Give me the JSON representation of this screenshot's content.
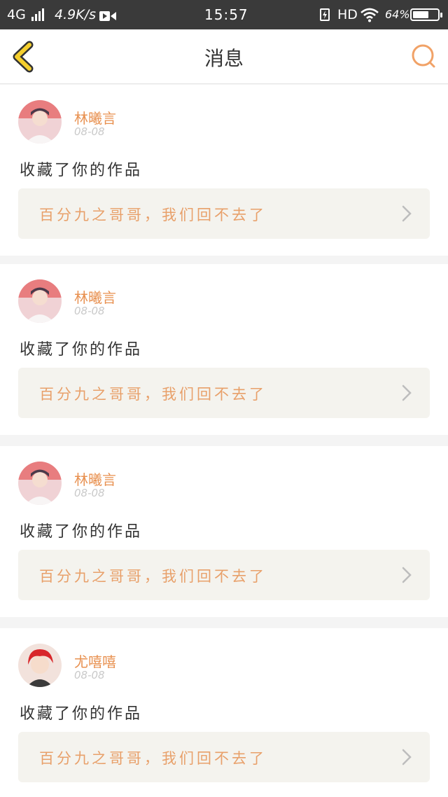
{
  "status_bar": {
    "network": "4G",
    "speed": "4.9K/s",
    "time": "15:57",
    "hd": "HD",
    "battery_percent": "64%",
    "battery_level": 0.64
  },
  "nav": {
    "title": "消息",
    "back_icon": "chevron-left-icon",
    "search_icon": "search-icon"
  },
  "colors": {
    "accent": "#e8904f",
    "back_icon": "#f5cf2e",
    "link_bg": "#f4f3ee"
  },
  "messages": [
    {
      "user": "林曦言",
      "date": "08-08",
      "action": "收藏了你的作品",
      "work": "百分九之哥哥，我们回不去了",
      "avatar": "avatar-pink"
    },
    {
      "user": "林曦言",
      "date": "08-08",
      "action": "收藏了你的作品",
      "work": "百分九之哥哥，我们回不去了",
      "avatar": "avatar-pink"
    },
    {
      "user": "林曦言",
      "date": "08-08",
      "action": "收藏了你的作品",
      "work": "百分九之哥哥，我们回不去了",
      "avatar": "avatar-pink"
    },
    {
      "user": "尤嘻嘻",
      "date": "08-08",
      "action": "收藏了你的作品",
      "work": "百分九之哥哥，我们回不去了",
      "avatar": "avatar-red-hair"
    }
  ]
}
